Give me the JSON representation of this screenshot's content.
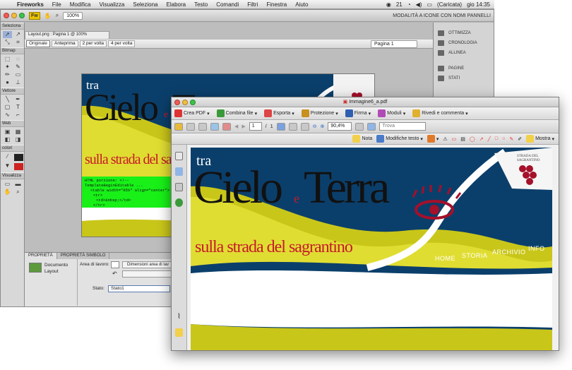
{
  "menubar": {
    "app": "Fireworks",
    "items": [
      "File",
      "Modifica",
      "Visualizza",
      "Seleziona",
      "Elabora",
      "Testo",
      "Comandi",
      "Filtri",
      "Finestra",
      "Aiuto"
    ],
    "number": "21",
    "battery": "(Caricata)",
    "clock": "gio 14:35"
  },
  "fw": {
    "logo": "Fw",
    "zoom": "100%",
    "mode": "MODALITÀ A ICONE CON NOMI PANNELLI",
    "doc_tab": "Layout.png : Pagina 1 @ 100%",
    "views": [
      "Originale",
      "Anteprima",
      "2 per volta",
      "4 per volta"
    ],
    "page_select": "Pagina 1",
    "tool_sections": [
      "Seleziona",
      "Bitmap",
      "Vettore",
      "Web",
      "colori",
      "Visualizza"
    ],
    "right_panels": [
      "OTTIMIZZA",
      "CRONOLOGIA",
      "ALLINEA",
      "PAGINE",
      "STATI"
    ],
    "code_overlay": [
      "HTML porzione: <!-- TemplateBeginEditable ...",
      "<table width=\"95%\" align=\"center\">",
      "<tr>",
      "<td>&nbsp;</td>",
      "</tr>"
    ],
    "props": {
      "tabs": [
        "PROPRIETÀ",
        "PROPRIETÀ SIMBOLO"
      ],
      "doc_label": "Documento",
      "doc_name": "Layout",
      "area_label": "Area di lavoro:",
      "dims_button": "Dimensioni area di lav",
      "stato_label": "Stato:",
      "stato_value": "Stato1"
    }
  },
  "banner": {
    "small": "tra",
    "cielo": "Cielo",
    "e": "e",
    "terra": "Terra",
    "subtitle": "sulla strada del sagrantino",
    "logo_text": "STRADA DEL SAGRANTINO"
  },
  "acro": {
    "title": "Immagine6_a.pdf",
    "tb1": [
      "Crea PDF",
      "Combina file",
      "Esporta",
      "Protezione",
      "Firma",
      "Moduli",
      "Rivedi e commenta"
    ],
    "page_current": "1",
    "page_sep": "/",
    "page_total": "1",
    "zoom": "90,4%",
    "find_placeholder": "Trova",
    "tb3": [
      "Nota",
      "Modifiche testo",
      "Mostra"
    ]
  },
  "nav": [
    "HOME",
    "STORIA",
    "ARCHIVIO",
    "INFO"
  ],
  "colors": {
    "navy": "#0b3f6b",
    "yellow": "#c9c61a",
    "lime": "#e0dd32",
    "red": "#a5102a",
    "green": "#27a83a"
  }
}
